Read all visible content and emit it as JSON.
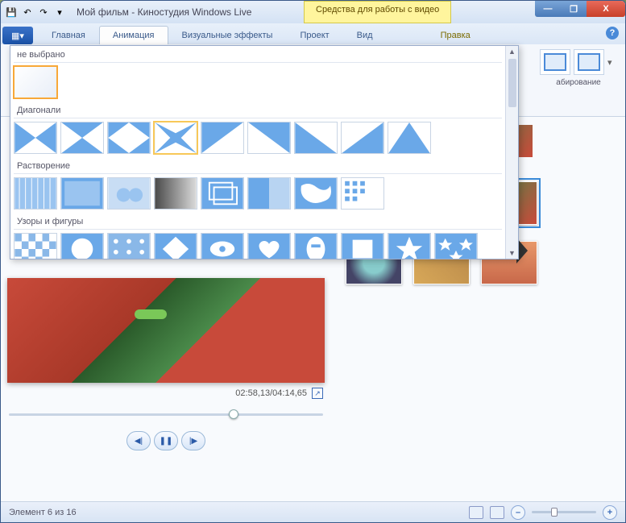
{
  "titlebar": {
    "title": "Мой фильм - Киностудия Windows Live",
    "context_tab": "Средства для работы с видео"
  },
  "winbuttons": {
    "min": "—",
    "max": "❐",
    "close": "X"
  },
  "ribbon": {
    "file_icon": "▦▾",
    "tabs": [
      "Главная",
      "Анимация",
      "Визуальные эффекты",
      "Проект",
      "Вид",
      "Правка"
    ],
    "active_tab": 1,
    "group_label_right": "абирование",
    "help": "?"
  },
  "transitions": {
    "categories": [
      {
        "name": "не выбрано",
        "items": [
          "none"
        ]
      },
      {
        "name": "Диагонали",
        "items": [
          "d1",
          "d2",
          "d3",
          "d4",
          "d5",
          "d6",
          "d7",
          "d8",
          "d9"
        ]
      },
      {
        "name": "Растворение",
        "items": [
          "r1",
          "r2",
          "r3",
          "r4",
          "r5",
          "r6",
          "r7",
          "r8"
        ]
      },
      {
        "name": "Узоры и фигуры",
        "items": [
          "p1",
          "p2",
          "p3",
          "p4",
          "p5",
          "p6",
          "p7",
          "p8",
          "p9",
          "p10",
          "p11"
        ]
      }
    ],
    "selected": "none",
    "hover": "d4"
  },
  "preview": {
    "time_display": "02:58,13/04:14,65",
    "controls": {
      "prev": "◀|",
      "pause": "❚❚",
      "next": "|▶"
    },
    "fullscreen": "↗"
  },
  "statusbar": {
    "text": "Элемент 6 из 16",
    "zoom_minus": "–",
    "zoom_plus": "+"
  }
}
